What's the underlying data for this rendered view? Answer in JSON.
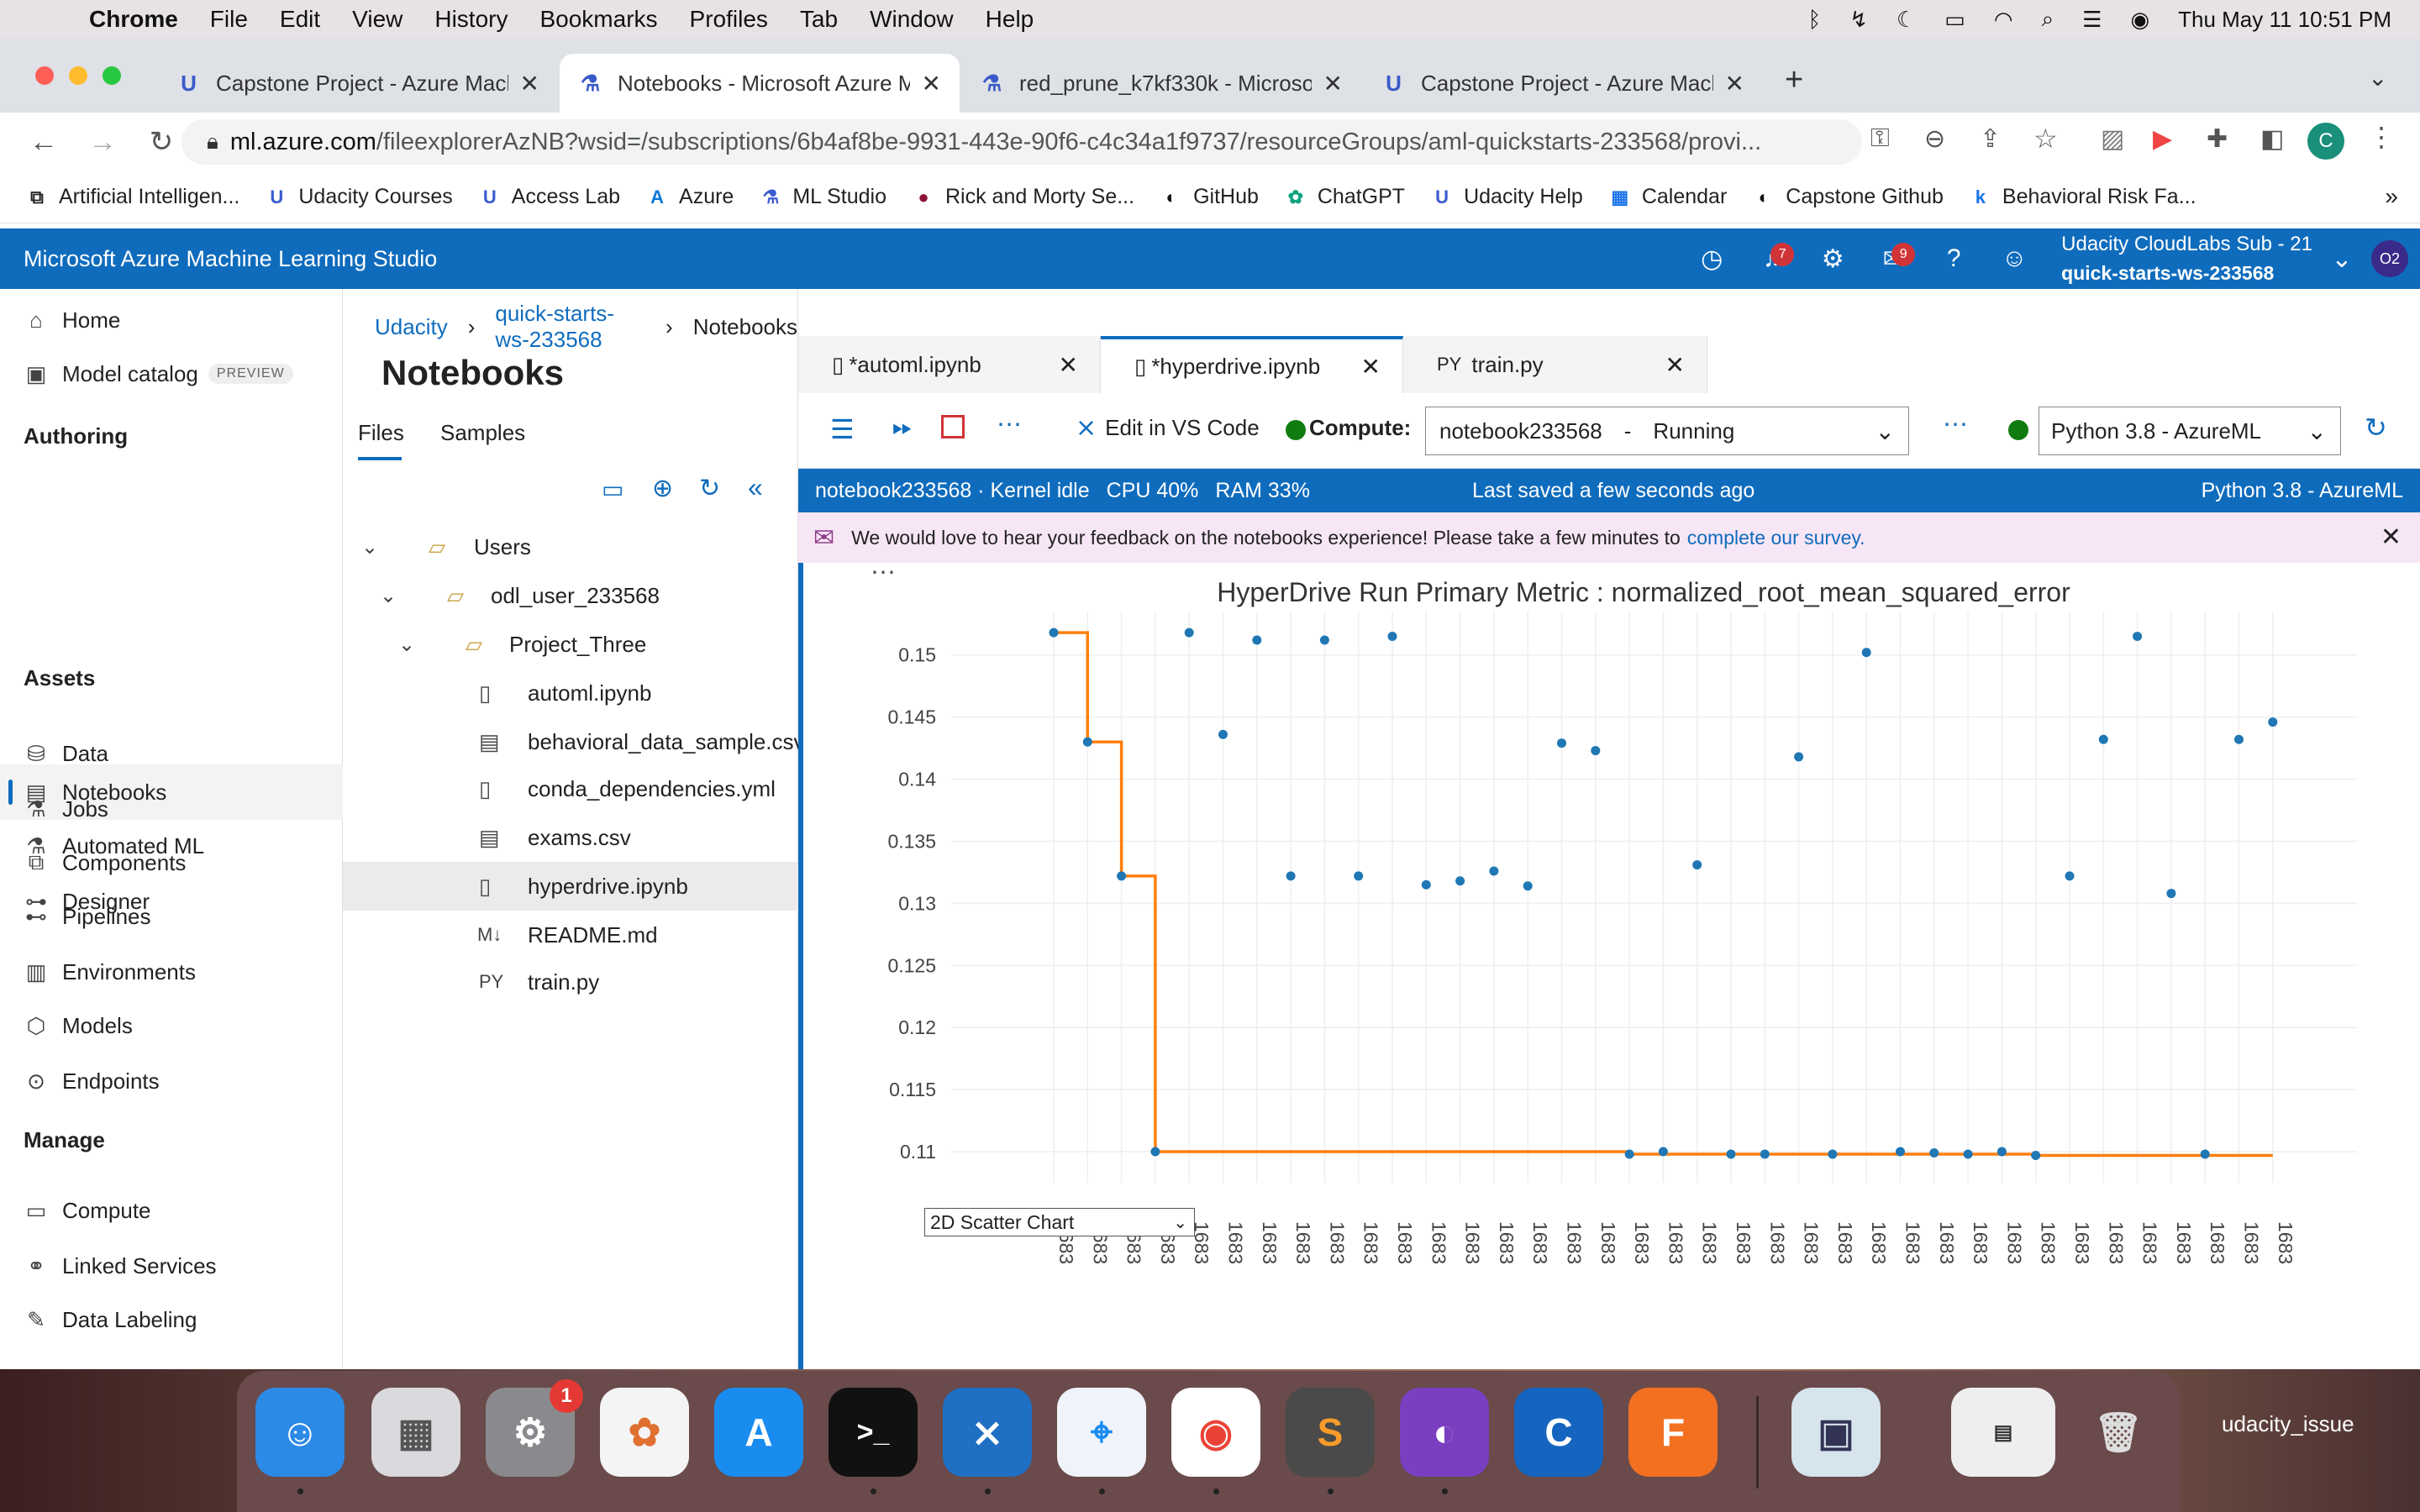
{
  "menubar": {
    "app": "Chrome",
    "items": [
      "File",
      "Edit",
      "View",
      "History",
      "Bookmarks",
      "Profiles",
      "Tab",
      "Window",
      "Help"
    ],
    "clock": "Thu May 11  10:51 PM"
  },
  "browser_tabs": [
    {
      "title": "Capstone Project - Azure Mach",
      "icon": "udacity-icon"
    },
    {
      "title": "Notebooks - Microsoft Azure M",
      "icon": "azure-ml-flask-icon"
    },
    {
      "title": "red_prune_k7kf330k - Microso",
      "icon": "azure-ml-flask-icon"
    },
    {
      "title": "Capstone Project - Azure Mach",
      "icon": "udacity-icon"
    }
  ],
  "url": {
    "host": "ml.azure.com",
    "path": "/fileexplorerAzNB?wsid=/subscriptions/6b4af8be-9931-443e-90f6-c4c34a1f9737/resourceGroups/aml-quickstarts-233568/provi..."
  },
  "bookmarks": [
    "Artificial Intelligen...",
    "Udacity Courses",
    "Access Lab",
    "Azure",
    "ML Studio",
    "Rick and Morty Se...",
    "GitHub",
    "ChatGPT",
    "Udacity Help",
    "Calendar",
    "Capstone Github",
    "Behavioral Risk Fa..."
  ],
  "azure": {
    "title": "Microsoft Azure Machine Learning Studio",
    "notif_count": "7",
    "feedback_count": "9",
    "account_line1": "Udacity CloudLabs Sub - 21",
    "account_line2": "quick-starts-ws-233568",
    "avatar": "O2"
  },
  "sidebar": {
    "home": "Home",
    "model_catalog": "Model catalog",
    "preview": "PREVIEW",
    "authoring": "Authoring",
    "notebooks": "Notebooks",
    "automl": "Automated ML",
    "designer": "Designer",
    "assets": "Assets",
    "data": "Data",
    "jobs": "Jobs",
    "components": "Components",
    "pipelines": "Pipelines",
    "environments": "Environments",
    "models": "Models",
    "endpoints": "Endpoints",
    "manage": "Manage",
    "compute": "Compute",
    "linked": "Linked Services",
    "labeling": "Data Labeling"
  },
  "breadcrumb": [
    "Udacity",
    "quick-starts-ws-233568",
    "Notebooks"
  ],
  "files": {
    "title": "Notebooks",
    "tab_files": "Files",
    "tab_samples": "Samples",
    "users": "Users",
    "user": "odl_user_233568",
    "project": "Project_Three",
    "items": [
      "automl.ipynb",
      "behavioral_data_sample.csv",
      "conda_dependencies.yml",
      "exams.csv",
      "hyperdrive.ipynb",
      "README.md",
      "train.py"
    ]
  },
  "editor_tabs": [
    "*automl.ipynb",
    "*hyperdrive.ipynb",
    "train.py"
  ],
  "toolbar": {
    "edit_vscode": "Edit in VS Code",
    "compute_label": "Compute:",
    "compute_value": "notebook233568",
    "compute_status": "Running",
    "kernel": "Python 3.8 - AzureML"
  },
  "kernelbar": {
    "left": "notebook233568 · Kernel idle",
    "cpu": "CPU 40%",
    "ram": "RAM 33%",
    "saved": "Last saved a few seconds ago",
    "right": "Python 3.8 - AzureML"
  },
  "feedback": {
    "text": "We would love to hear your feedback on the notebooks experience! Please take a few minutes to",
    "link": "complete our survey."
  },
  "chart_select": "2D Scatter Chart",
  "chart_data": {
    "type": "scatter",
    "title": "HyperDrive Run Primary Metric : normalized_root_mean_squared_error",
    "xlabel": "",
    "ylabel": "",
    "ylim": [
      0.1075,
      0.1535
    ],
    "y_ticks": [
      "0.15",
      "0.145",
      "0.14",
      "0.135",
      "0.13",
      "0.125",
      "0.12",
      "0.115",
      "0.11"
    ],
    "x_tick_label": "1683",
    "points": [
      0.1518,
      0.143,
      0.1322,
      0.11,
      0.1518,
      0.1436,
      0.1512,
      0.1322,
      0.1512,
      0.1322,
      0.1515,
      0.1315,
      0.1318,
      0.1326,
      0.1314,
      0.1429,
      0.1423,
      0.1098,
      0.11,
      0.1331,
      0.1098,
      0.1098,
      0.1418,
      0.1098,
      0.1502,
      0.11,
      0.1099,
      0.1098,
      0.11,
      0.1097,
      0.1322,
      0.1432,
      0.1515,
      0.1308,
      0.1098,
      0.1432,
      0.1446
    ],
    "best_so_far": [
      0.1518,
      0.143,
      0.1322,
      0.11,
      0.11,
      0.11,
      0.11,
      0.11,
      0.11,
      0.11,
      0.11,
      0.11,
      0.11,
      0.11,
      0.11,
      0.11,
      0.11,
      0.1098,
      0.1098,
      0.1098,
      0.1098,
      0.1098,
      0.1098,
      0.1098,
      0.1098,
      0.1098,
      0.1098,
      0.1098,
      0.1098,
      0.1097,
      0.1097,
      0.1097,
      0.1097,
      0.1097,
      0.1097,
      0.1097,
      0.1097
    ],
    "colors": {
      "points": "#1f77b4",
      "best_line": "#ff7f0e"
    },
    "grid": true
  },
  "dock_label": "udacity_issue",
  "dock_badge": "1"
}
